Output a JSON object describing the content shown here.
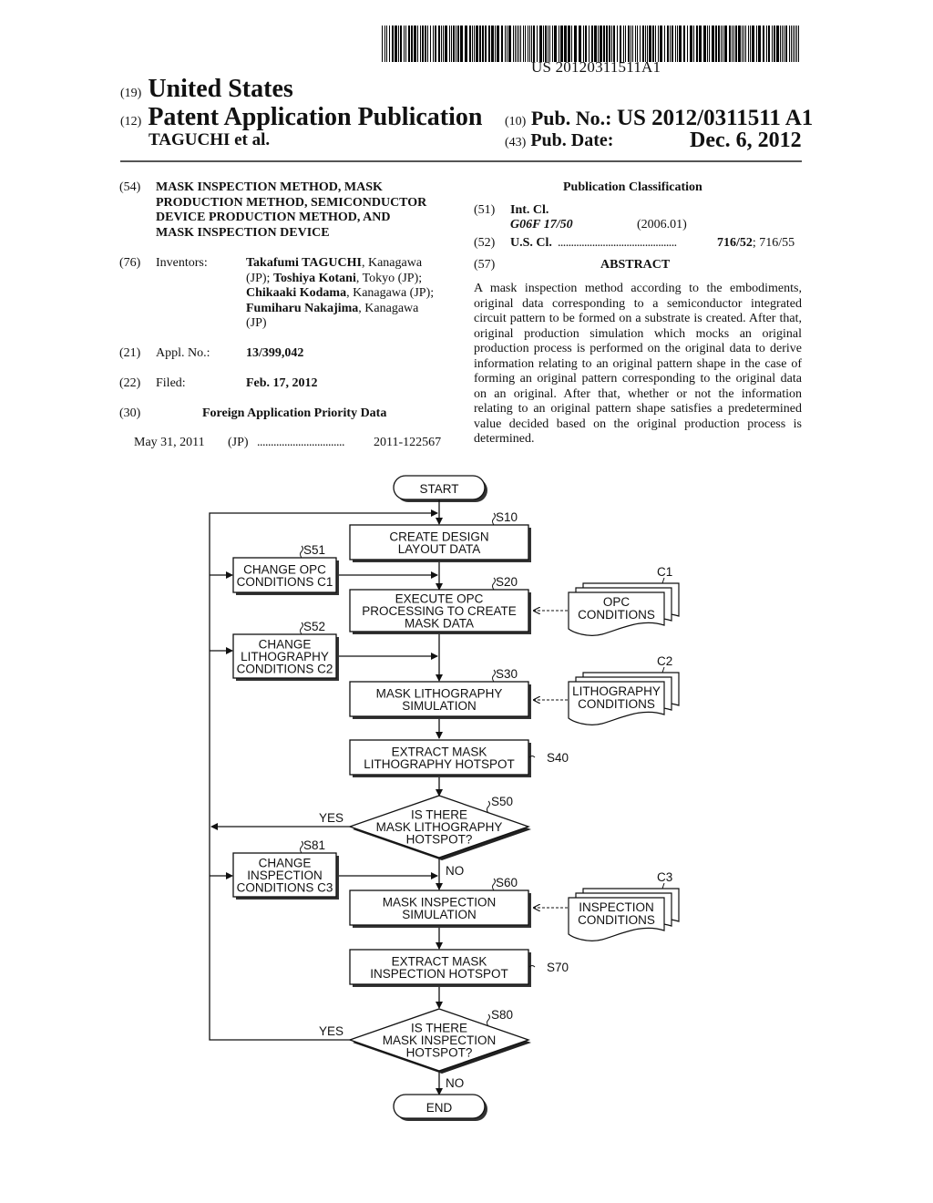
{
  "header": {
    "barcode_label": "US 20120311511A1",
    "country_code": "(19)",
    "country": "United States",
    "doc_type_code": "(12)",
    "doc_type": "Patent Application Publication",
    "author": "TAGUCHI et al.",
    "pub_no_code": "(10)",
    "pub_no_label": "Pub. No.:",
    "pub_no": "US 2012/0311511 A1",
    "pub_date_code": "(43)",
    "pub_date_label": "Pub. Date:",
    "pub_date": "Dec. 6, 2012"
  },
  "left": {
    "title_code": "(54)",
    "title_lines": [
      "MASK INSPECTION METHOD, MASK",
      "PRODUCTION METHOD, SEMICONDUCTOR",
      "DEVICE PRODUCTION METHOD, AND",
      "MASK INSPECTION DEVICE"
    ],
    "inventors_code": "(76)",
    "inventors_label": "Inventors:",
    "inventors": [
      {
        "name": "Takafumi TAGUCHI",
        "loc": ", Kanagawa"
      },
      {
        "name": "Toshiya Kotani",
        "loc": ", Tokyo (JP);"
      },
      {
        "name": "Chikaaki Kodama",
        "loc": ", Kanagawa (JP);"
      },
      {
        "name": "Fumiharu Nakajima",
        "loc": ", Kanagawa"
      }
    ],
    "inventors_extra": [
      "(JP);",
      "(JP)"
    ],
    "appl_code": "(21)",
    "appl_label": "Appl. No.:",
    "appl_no": "13/399,042",
    "filed_code": "(22)",
    "filed_label": "Filed:",
    "filed": "Feb. 17, 2012",
    "foreign_code": "(30)",
    "foreign_title": "Foreign Application Priority Data",
    "foreign_date": "May 31, 2011",
    "foreign_country": "(JP)",
    "foreign_dots": "................................",
    "foreign_no": "2011-122567"
  },
  "right": {
    "classification_title": "Publication Classification",
    "intcl_code": "(51)",
    "intcl_label": "Int. Cl.",
    "intcl_value": "G06F 17/50",
    "intcl_year": "(2006.01)",
    "uscl_code": "(52)",
    "uscl_label": "U.S. Cl.",
    "uscl_dots": ".............................................",
    "uscl_main": "716/52",
    "uscl_rest": "; 716/55",
    "abstract_code": "(57)",
    "abstract_title": "ABSTRACT",
    "abstract_text": "A mask inspection method according to the embodiments, original data corresponding to a semiconductor integrated circuit pattern to be formed on a substrate is created. After that, original production simulation which mocks an original production process is performed on the original data to derive information relating to an original pattern shape in the case of forming an original pattern corresponding to the original data on an original. After that, whether or not the information relating to an original pattern shape satisfies a predetermined value decided based on the original production process is determined."
  },
  "flowchart": {
    "start": "START",
    "end": "END",
    "steps": {
      "s10": {
        "id": "S10",
        "lines": [
          "CREATE DESIGN",
          "LAYOUT DATA"
        ]
      },
      "s20": {
        "id": "S20",
        "lines": [
          "EXECUTE OPC",
          "PROCESSING TO CREATE",
          "MASK DATA"
        ]
      },
      "s30": {
        "id": "S30",
        "lines": [
          "MASK LITHOGRAPHY",
          "SIMULATION"
        ]
      },
      "s40": {
        "id": "S40",
        "lines": [
          "EXTRACT MASK",
          "LITHOGRAPHY HOTSPOT"
        ]
      },
      "s50": {
        "id": "S50",
        "lines": [
          "IS THERE",
          "MASK LITHOGRAPHY",
          "HOTSPOT?"
        ]
      },
      "s60": {
        "id": "S60",
        "lines": [
          "MASK INSPECTION",
          "SIMULATION"
        ]
      },
      "s70": {
        "id": "S70",
        "lines": [
          "EXTRACT MASK",
          "INSPECTION HOTSPOT"
        ]
      },
      "s80": {
        "id": "S80",
        "lines": [
          "IS THERE",
          "MASK INSPECTION",
          "HOTSPOT?"
        ]
      },
      "s51": {
        "id": "S51",
        "lines": [
          "CHANGE OPC",
          "CONDITIONS C1"
        ]
      },
      "s52": {
        "id": "S52",
        "lines": [
          "CHANGE",
          "LITHOGRAPHY",
          "CONDITIONS C2"
        ]
      },
      "s81": {
        "id": "S81",
        "lines": [
          "CHANGE",
          "INSPECTION",
          "CONDITIONS C3"
        ]
      }
    },
    "docs": {
      "c1": {
        "id": "C1",
        "lines": [
          "OPC",
          "CONDITIONS"
        ]
      },
      "c2": {
        "id": "C2",
        "lines": [
          "LITHOGRAPHY",
          "CONDITIONS"
        ]
      },
      "c3": {
        "id": "C3",
        "lines": [
          "INSPECTION",
          "CONDITIONS"
        ]
      }
    },
    "yes": "YES",
    "no": "NO"
  }
}
